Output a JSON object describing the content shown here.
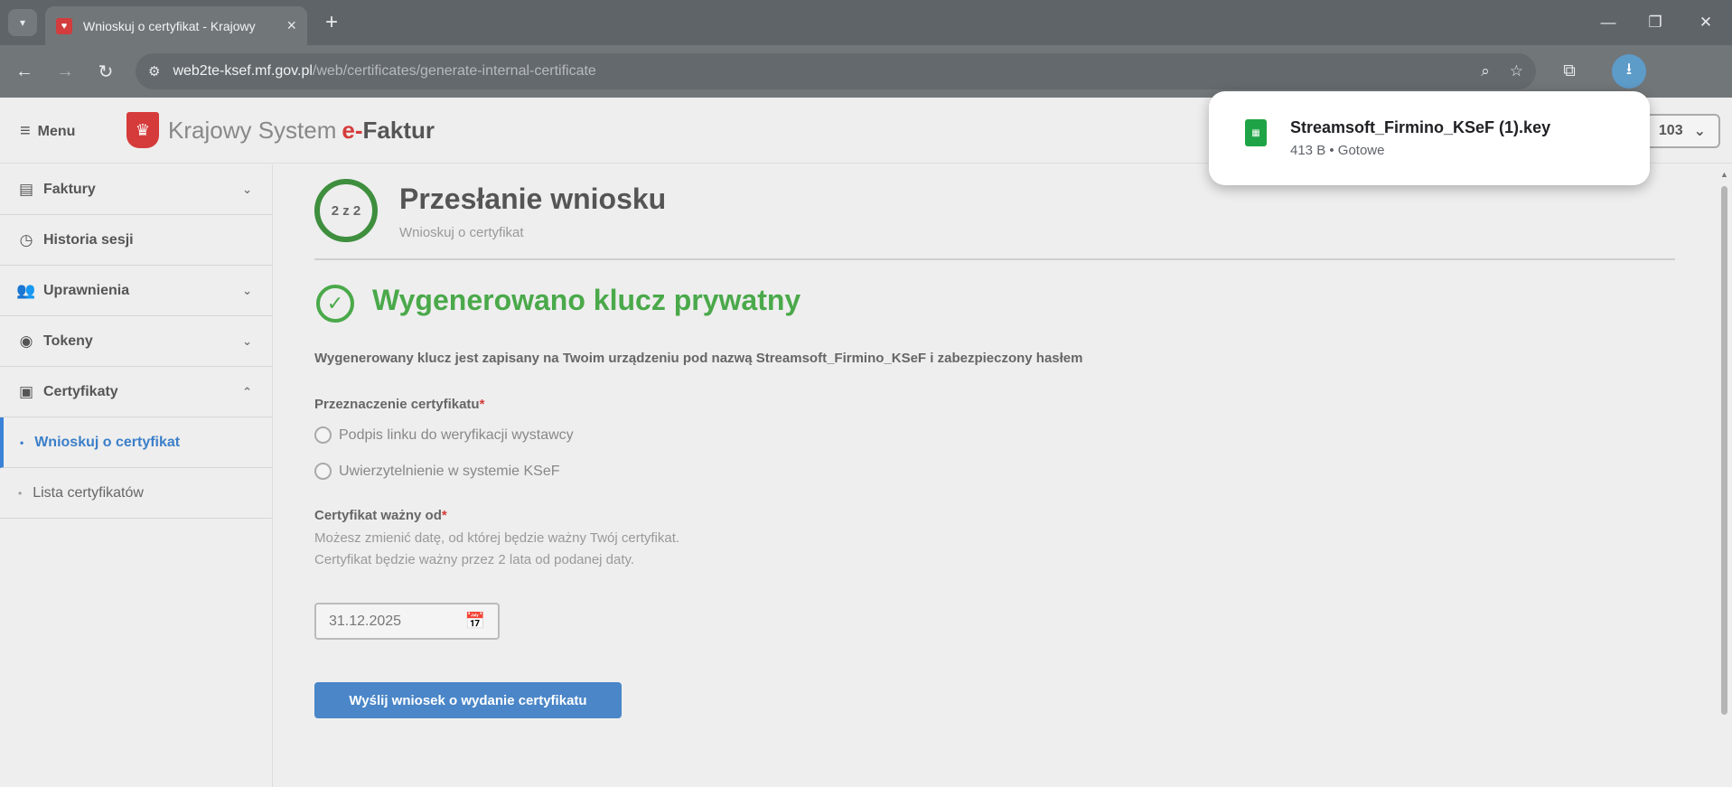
{
  "browser": {
    "tab_title": "Wnioskuj o certyfikat - Krajowy",
    "url_host": "web2te-ksef.mf.gov.pl",
    "url_path": "/web/certificates/generate-internal-certificate"
  },
  "header": {
    "menu_label": "Menu",
    "brand_regular": "Krajowy System",
    "brand_e": "e-",
    "brand_bold": "Faktur",
    "user_select_value": "103"
  },
  "sidebar": {
    "items": [
      {
        "label": "Faktury"
      },
      {
        "label": "Historia sesji"
      },
      {
        "label": "Uprawnienia"
      },
      {
        "label": "Tokeny"
      },
      {
        "label": "Certyfikaty"
      }
    ],
    "sub_items": [
      {
        "label": "Wnioskuj o certyfikat"
      },
      {
        "label": "Lista certyfikatów"
      }
    ]
  },
  "main": {
    "step_indicator": "2 z 2",
    "step_title": "Przesłanie wniosku",
    "step_subtitle": "Wnioskuj o certyfikat",
    "success_title": "Wygenerowano klucz prywatny",
    "info_text": "Wygenerowany klucz jest zapisany na Twoim urządzeniu pod nazwą Streamsoft_Firmino_KSeF i zabezpieczony hasłem",
    "purpose_label": "Przeznaczenie certyfikatu",
    "purpose_options": [
      "Podpis linku do weryfikacji wystawcy",
      "Uwierzytelnienie w systemie KSeF"
    ],
    "valid_from_label": "Certyfikat ważny od",
    "valid_from_help": "Możesz zmienić datę, od której będzie ważny Twój certyfikat. Certyfikat będzie ważny przez 2 lata od podanej daty.",
    "date_value": "31.12.2025",
    "submit_label": "Wyślij wniosek o wydanie certyfikatu",
    "required_mark": "*"
  },
  "download": {
    "file_name": "Streamsoft_Firmino_KSeF (1).key",
    "status": "413 B • Gotowe"
  },
  "colors": {
    "accent_green": "#4aa94a",
    "brand_red": "#d63b3b",
    "primary_blue": "#4a86c8"
  }
}
